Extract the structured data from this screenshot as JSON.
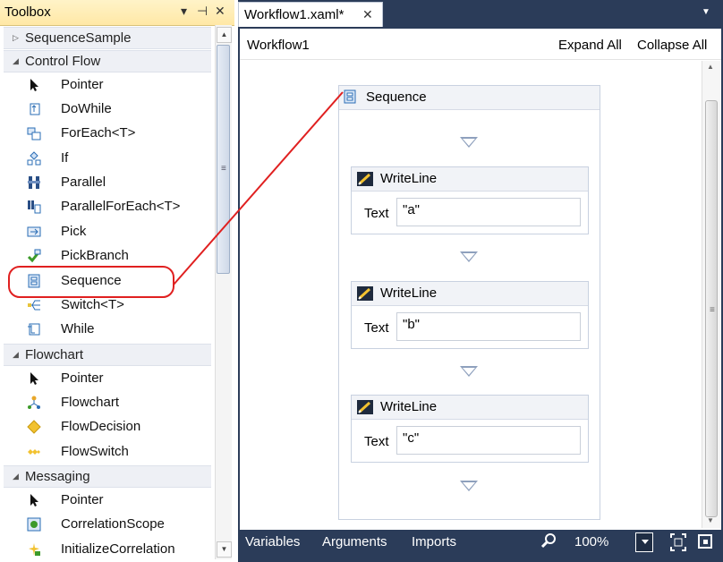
{
  "toolbox": {
    "title": "Toolbox",
    "pin_glyph": "▾ ⊣",
    "close_glyph": "✕",
    "groups": [
      {
        "label": "SequenceSample",
        "expanded": false
      },
      {
        "label": "Control Flow",
        "expanded": true,
        "items": [
          "Pointer",
          "DoWhile",
          "ForEach<T>",
          "If",
          "Parallel",
          "ParallelForEach<T>",
          "Pick",
          "PickBranch",
          "Sequence",
          "Switch<T>",
          "While"
        ]
      },
      {
        "label": "Flowchart",
        "expanded": true,
        "items": [
          "Pointer",
          "Flowchart",
          "FlowDecision",
          "FlowSwitch"
        ]
      },
      {
        "label": "Messaging",
        "expanded": true,
        "items": [
          "Pointer",
          "CorrelationScope",
          "InitializeCorrelation"
        ]
      }
    ]
  },
  "document_tab": {
    "title": "Workflow1.xaml*",
    "close_glyph": "✕"
  },
  "designer": {
    "breadcrumb": "Workflow1",
    "expand_all": "Expand All",
    "collapse_all": "Collapse All",
    "sequence": {
      "title": "Sequence",
      "activities": [
        {
          "title": "WriteLine",
          "property_label": "Text",
          "property_value": "\"a\""
        },
        {
          "title": "WriteLine",
          "property_label": "Text",
          "property_value": "\"b\""
        },
        {
          "title": "WriteLine",
          "property_label": "Text",
          "property_value": "\"c\""
        }
      ]
    }
  },
  "bottom_bar": {
    "variables": "Variables",
    "arguments": "Arguments",
    "imports": "Imports",
    "zoom": "100%"
  },
  "colors": {
    "highlight": "#e02020",
    "designer_dark": "#2b3c59",
    "toolbox_title_bg": "#ffe8a6"
  }
}
